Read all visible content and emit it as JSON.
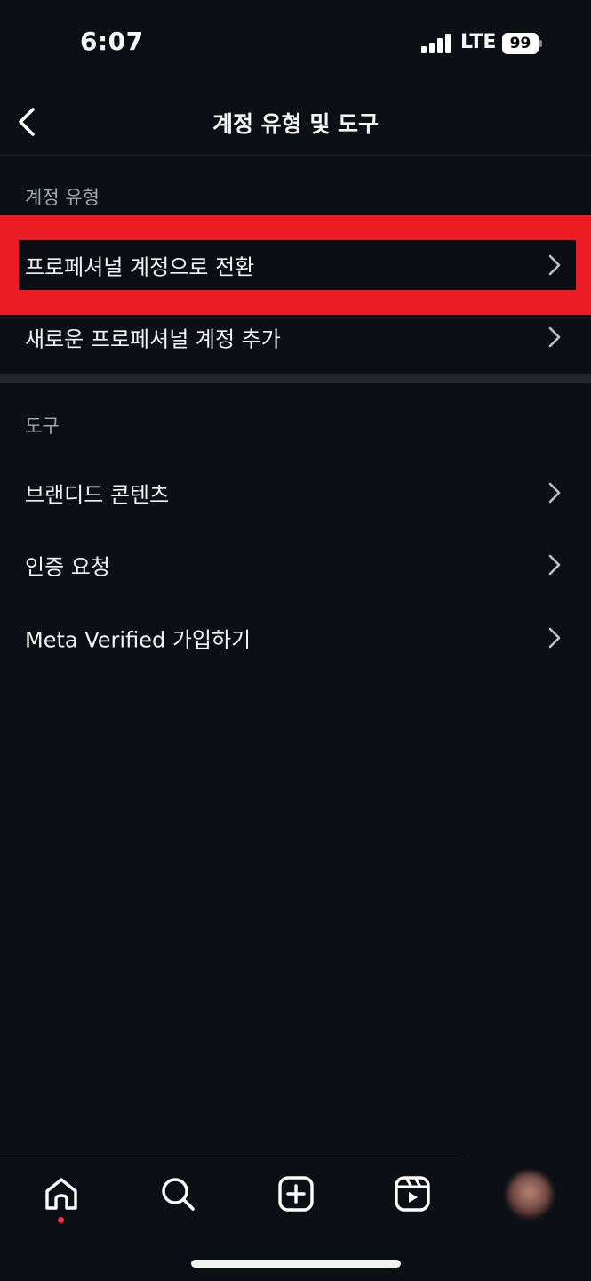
{
  "status_bar": {
    "time": "6:07",
    "network": "LTE",
    "battery": "99"
  },
  "header": {
    "title": "계정 유형 및 도구"
  },
  "account_type": {
    "heading": "계정 유형",
    "items": [
      {
        "label": "프로페셔널 계정으로 전환"
      },
      {
        "label": "새로운 프로페셔널 계정 추가"
      }
    ]
  },
  "tools": {
    "heading": "도구",
    "items": [
      {
        "label": "브랜디드 콘텐츠"
      },
      {
        "label": "인증 요청"
      },
      {
        "label": "Meta Verified 가입하기"
      }
    ]
  },
  "tab_bar": {
    "tabs": [
      {
        "icon": "home-icon",
        "active": true
      },
      {
        "icon": "search-icon"
      },
      {
        "icon": "create-post-icon"
      },
      {
        "icon": "reels-icon"
      },
      {
        "icon": "profile-avatar"
      }
    ]
  },
  "colors": {
    "background": "#0c0f14",
    "highlight": "#ec1c24",
    "notification_dot": "#ff2b40",
    "section_label": "#a2a7ae"
  }
}
